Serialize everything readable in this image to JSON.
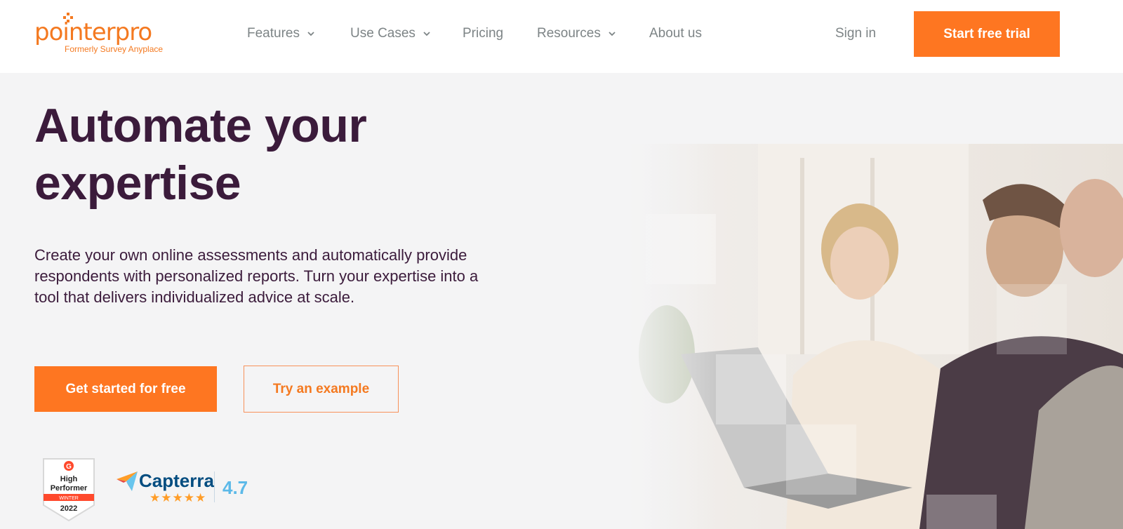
{
  "brand": {
    "name": "pointerpro",
    "tagline": "Formerly Survey Anyplace",
    "accent": "#fe7621",
    "dark": "#3b1b3b"
  },
  "nav": {
    "items": [
      {
        "label": "Features",
        "has_dropdown": true
      },
      {
        "label": "Use Cases",
        "has_dropdown": true
      },
      {
        "label": "Pricing",
        "has_dropdown": false
      },
      {
        "label": "Resources",
        "has_dropdown": true
      },
      {
        "label": "About us",
        "has_dropdown": false
      }
    ],
    "sign_in": "Sign in",
    "cta": "Start free trial"
  },
  "hero": {
    "title_line1": "Automate your",
    "title_line2": "expertise",
    "description": "Create your own online assessments and automatically provide respondents with personalized reports. Turn your expertise into a tool that delivers individualized advice at scale.",
    "primary_button": "Get started for free",
    "secondary_button": "Try an example"
  },
  "badges": {
    "g2": {
      "line1": "High",
      "line2": "Performer",
      "season": "WINTER",
      "year": "2022"
    },
    "capterra": {
      "name": "Capterra",
      "rating": "4.7",
      "stars": "★★★★★"
    }
  }
}
